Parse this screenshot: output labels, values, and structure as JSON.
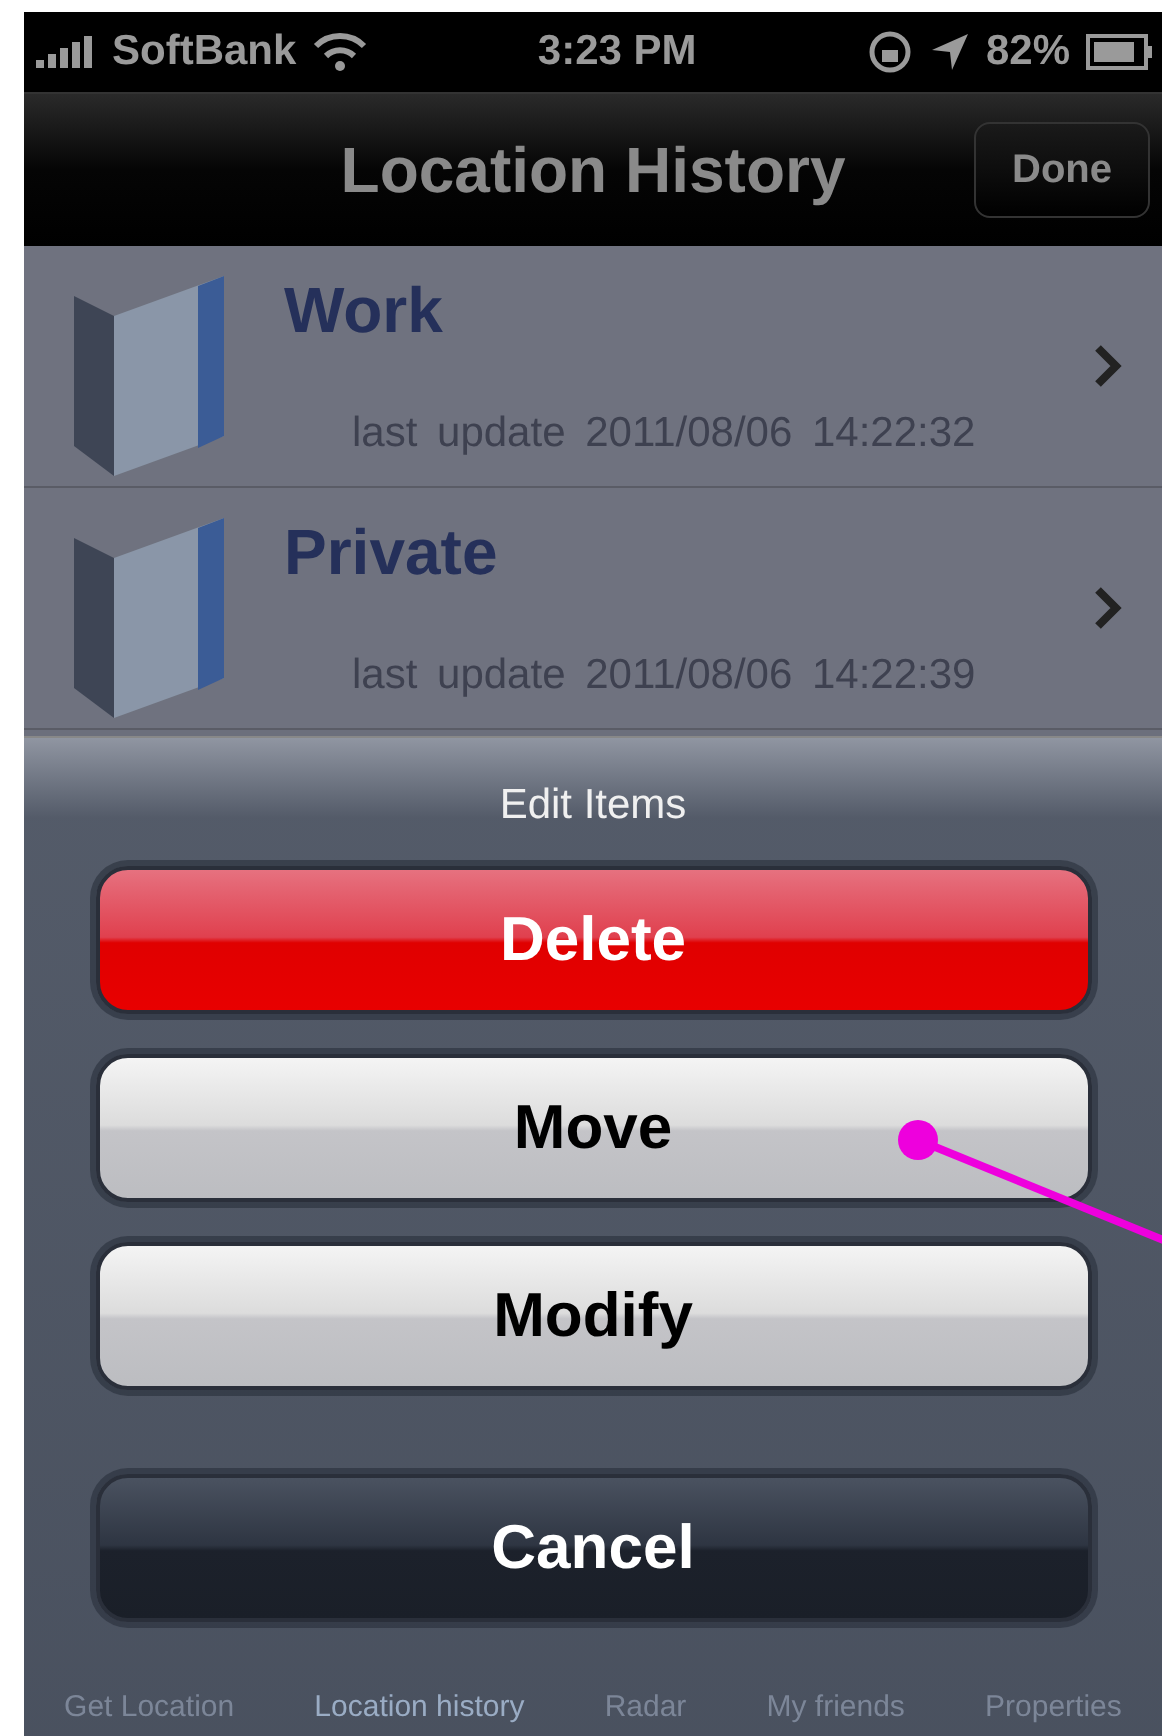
{
  "status_bar": {
    "carrier": "SoftBank",
    "time": "3:23 PM",
    "battery": "82%"
  },
  "nav_bar": {
    "title": "Location History",
    "done_button": "Done"
  },
  "list": [
    {
      "name": "Work",
      "detail_label": "last update",
      "timestamp": "2011/08/06 14:22:32"
    },
    {
      "name": "Private",
      "detail_label": "last update",
      "timestamp": "2011/08/06 14:22:39"
    }
  ],
  "tab_bar": {
    "items": [
      {
        "label": "Get Location",
        "selected": false
      },
      {
        "label": "Location history",
        "selected": true
      },
      {
        "label": "Radar",
        "selected": false
      },
      {
        "label": "My friends",
        "selected": false
      },
      {
        "label": "Properties",
        "selected": false
      }
    ]
  },
  "action_sheet": {
    "title": "Edit Items",
    "buttons": [
      {
        "label": "Delete",
        "kind": "destructive"
      },
      {
        "label": "Move",
        "kind": "default"
      },
      {
        "label": "Modify",
        "kind": "default"
      },
      {
        "label": "Cancel",
        "kind": "cancel"
      }
    ]
  }
}
